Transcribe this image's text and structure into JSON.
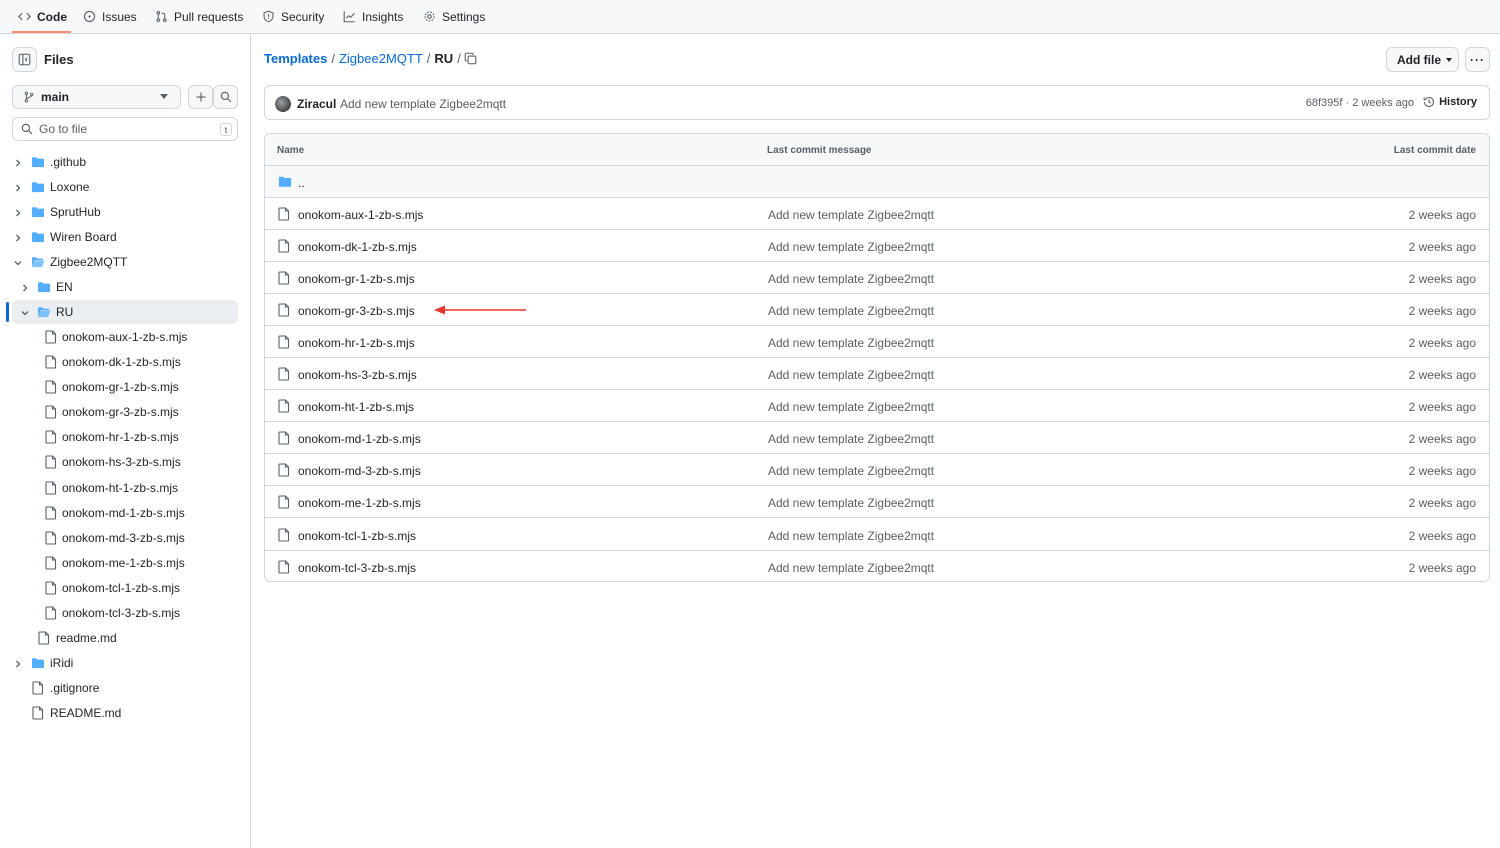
{
  "topnav": {
    "tabs": [
      {
        "label": "Code",
        "icon": "code-icon"
      },
      {
        "label": "Issues",
        "icon": "issue-icon"
      },
      {
        "label": "Pull requests",
        "icon": "pull-request-icon"
      },
      {
        "label": "Security",
        "icon": "shield-icon"
      },
      {
        "label": "Insights",
        "icon": "graph-icon"
      },
      {
        "label": "Settings",
        "icon": "gear-icon"
      }
    ],
    "active": "Code"
  },
  "sidebar": {
    "title": "Files",
    "branch": "main",
    "goto_placeholder": "Go to file",
    "goto_shortcut": "t",
    "tree": [
      {
        "label": ".github",
        "type": "folder",
        "expanded": false,
        "level": 0
      },
      {
        "label": "Loxone",
        "type": "folder",
        "expanded": false,
        "level": 0
      },
      {
        "label": "SprutHub",
        "type": "folder",
        "expanded": false,
        "level": 0
      },
      {
        "label": "Wiren Board",
        "type": "folder",
        "expanded": false,
        "level": 0
      },
      {
        "label": "Zigbee2MQTT",
        "type": "folder",
        "expanded": true,
        "level": 0
      },
      {
        "label": "EN",
        "type": "folder",
        "expanded": false,
        "level": 1
      },
      {
        "label": "RU",
        "type": "folder",
        "expanded": true,
        "level": 1,
        "selected": true
      },
      {
        "label": "onokom-aux-1-zb-s.mjs",
        "type": "file",
        "level": 2
      },
      {
        "label": "onokom-dk-1-zb-s.mjs",
        "type": "file",
        "level": 2
      },
      {
        "label": "onokom-gr-1-zb-s.mjs",
        "type": "file",
        "level": 2
      },
      {
        "label": "onokom-gr-3-zb-s.mjs",
        "type": "file",
        "level": 2
      },
      {
        "label": "onokom-hr-1-zb-s.mjs",
        "type": "file",
        "level": 2
      },
      {
        "label": "onokom-hs-3-zb-s.mjs",
        "type": "file",
        "level": 2
      },
      {
        "label": "onokom-ht-1-zb-s.mjs",
        "type": "file",
        "level": 2
      },
      {
        "label": "onokom-md-1-zb-s.mjs",
        "type": "file",
        "level": 2
      },
      {
        "label": "onokom-md-3-zb-s.mjs",
        "type": "file",
        "level": 2
      },
      {
        "label": "onokom-me-1-zb-s.mjs",
        "type": "file",
        "level": 2
      },
      {
        "label": "onokom-tcl-1-zb-s.mjs",
        "type": "file",
        "level": 2
      },
      {
        "label": "onokom-tcl-3-zb-s.mjs",
        "type": "file",
        "level": 2
      },
      {
        "label": "readme.md",
        "type": "file",
        "level": 1
      },
      {
        "label": "iRidi",
        "type": "folder",
        "expanded": false,
        "level": 0
      },
      {
        "label": ".gitignore",
        "type": "file",
        "level": 0
      },
      {
        "label": "README.md",
        "type": "file",
        "level": 0
      }
    ]
  },
  "breadcrumb": {
    "parts": [
      "Templates",
      "Zigbee2MQTT",
      "RU"
    ],
    "sep": "/"
  },
  "toolbar": {
    "add_file": "Add file",
    "more": "···"
  },
  "commit": {
    "author": "Ziracul",
    "message": "Add new template Zigbee2mqtt",
    "meta": "68f395f · 2 weeks ago",
    "history": "History"
  },
  "table": {
    "headers": {
      "name": "Name",
      "message": "Last commit message",
      "date": "Last commit date"
    },
    "parent": "..",
    "rows": [
      {
        "name": "onokom-aux-1-zb-s.mjs",
        "message": "Add new template Zigbee2mqtt",
        "date": "2 weeks ago"
      },
      {
        "name": "onokom-dk-1-zb-s.mjs",
        "message": "Add new template Zigbee2mqtt",
        "date": "2 weeks ago"
      },
      {
        "name": "onokom-gr-1-zb-s.mjs",
        "message": "Add new template Zigbee2mqtt",
        "date": "2 weeks ago"
      },
      {
        "name": "onokom-gr-3-zb-s.mjs",
        "message": "Add new template Zigbee2mqtt",
        "date": "2 weeks ago",
        "highlighted": true
      },
      {
        "name": "onokom-hr-1-zb-s.mjs",
        "message": "Add new template Zigbee2mqtt",
        "date": "2 weeks ago"
      },
      {
        "name": "onokom-hs-3-zb-s.mjs",
        "message": "Add new template Zigbee2mqtt",
        "date": "2 weeks ago"
      },
      {
        "name": "onokom-ht-1-zb-s.mjs",
        "message": "Add new template Zigbee2mqtt",
        "date": "2 weeks ago"
      },
      {
        "name": "onokom-md-1-zb-s.mjs",
        "message": "Add new template Zigbee2mqtt",
        "date": "2 weeks ago"
      },
      {
        "name": "onokom-md-3-zb-s.mjs",
        "message": "Add new template Zigbee2mqtt",
        "date": "2 weeks ago"
      },
      {
        "name": "onokom-me-1-zb-s.mjs",
        "message": "Add new template Zigbee2mqtt",
        "date": "2 weeks ago"
      },
      {
        "name": "onokom-tcl-1-zb-s.mjs",
        "message": "Add new template Zigbee2mqtt",
        "date": "2 weeks ago"
      },
      {
        "name": "onokom-tcl-3-zb-s.mjs",
        "message": "Add new template Zigbee2mqtt",
        "date": "2 weeks ago"
      }
    ]
  },
  "colors": {
    "accent": "#0969da",
    "folder": "#54aeff",
    "annotation_arrow": "#e5382a",
    "tab_underline": "#fd8c73"
  }
}
